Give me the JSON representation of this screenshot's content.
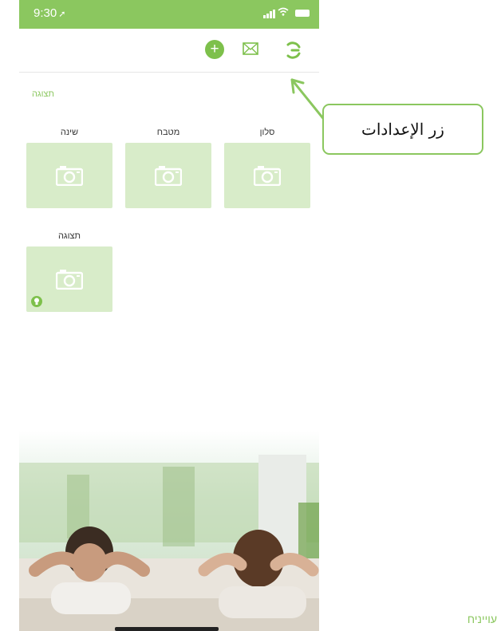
{
  "status_bar": {
    "time": "9:30",
    "location_arrow": "➚"
  },
  "toolbar": {
    "add_icon": "plus-circle-icon",
    "mail_icon": "envelope-icon",
    "settings_icon": "settings-icon"
  },
  "section": {
    "title": "תצוגה"
  },
  "rooms": [
    {
      "label": "שינה"
    },
    {
      "label": "מטבח"
    },
    {
      "label": "סלון"
    },
    {
      "label": "תצוגה"
    }
  ],
  "callout": {
    "text": "زر الإعدادات"
  },
  "footer": {
    "text": "עוייניח"
  },
  "colors": {
    "accent": "#8bc75f",
    "tile": "#d8ecc9"
  }
}
